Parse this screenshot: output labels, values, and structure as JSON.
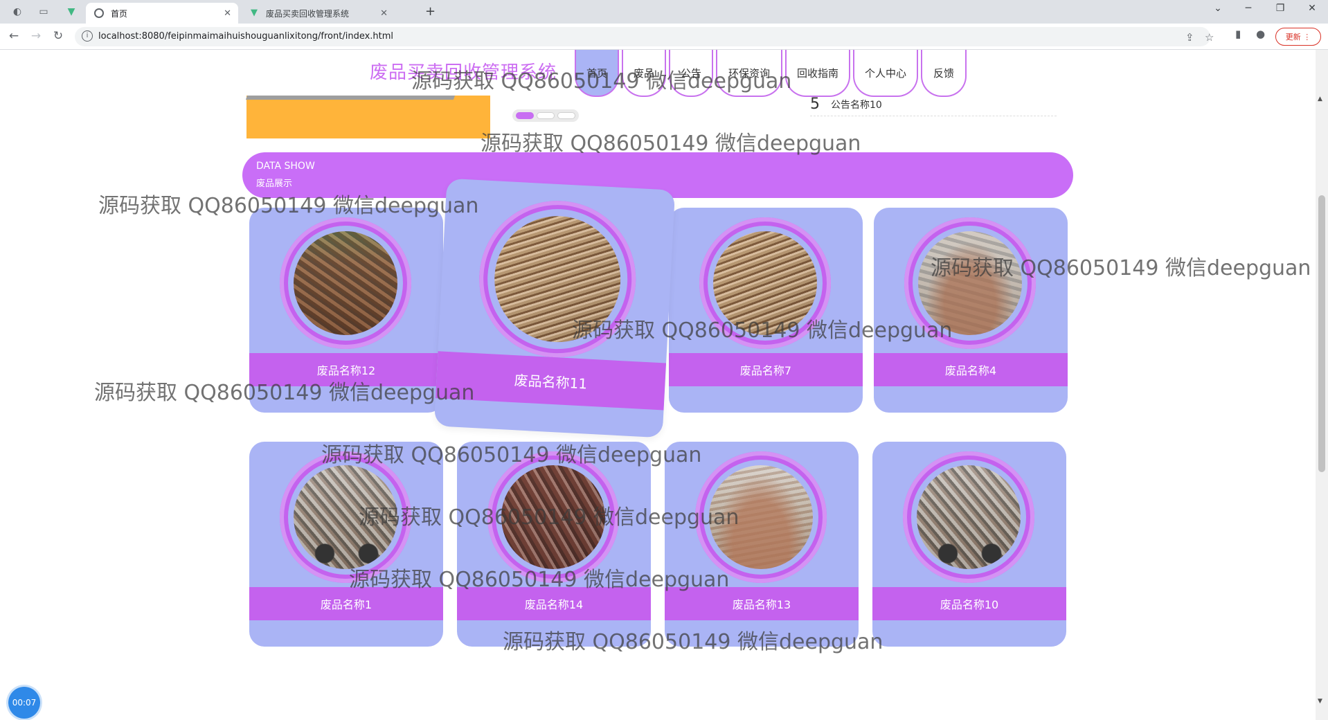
{
  "browser": {
    "active_tab_title": "首页",
    "inactive_tab_title": "废品买卖回收管理系统",
    "new_tab_symbol": "+",
    "url": "localhost:8080/feipinmaimaihuishouguanlixitong/front/index.html",
    "update_label": "更新"
  },
  "site": {
    "title": "废品买卖回收管理系统",
    "nav": [
      {
        "label": "首页",
        "active": true
      },
      {
        "label": "废品",
        "active": false
      },
      {
        "label": "公告",
        "active": false
      },
      {
        "label": "环保资询",
        "active": false
      },
      {
        "label": "回收指南",
        "active": false
      },
      {
        "label": "个人中心",
        "active": false
      },
      {
        "label": "反馈",
        "active": false
      }
    ]
  },
  "notice": {
    "number": "5",
    "title": "公告名称10"
  },
  "section": {
    "en": "DATA SHOW",
    "zh": "废品展示"
  },
  "products": [
    {
      "name": "废品名称12",
      "photo": "ph-rust"
    },
    {
      "name": "废品名称11",
      "photo": "ph-card"
    },
    {
      "name": "废品名称7",
      "photo": "ph-card"
    },
    {
      "name": "废品名称4",
      "photo": "ph-dump"
    },
    {
      "name": "废品名称1",
      "photo": "ph-truck"
    },
    {
      "name": "废品名称14",
      "photo": "ph-copper"
    },
    {
      "name": "废品名称13",
      "photo": "ph-yard"
    },
    {
      "name": "废品名称10",
      "photo": "ph-truck"
    }
  ],
  "watermark": "源码获取 QQ86050149 微信deepguan",
  "timer": "00:07",
  "colors": {
    "accent": "#c96ef7",
    "card": "#aab4f5",
    "title": "#cc6ef2"
  }
}
